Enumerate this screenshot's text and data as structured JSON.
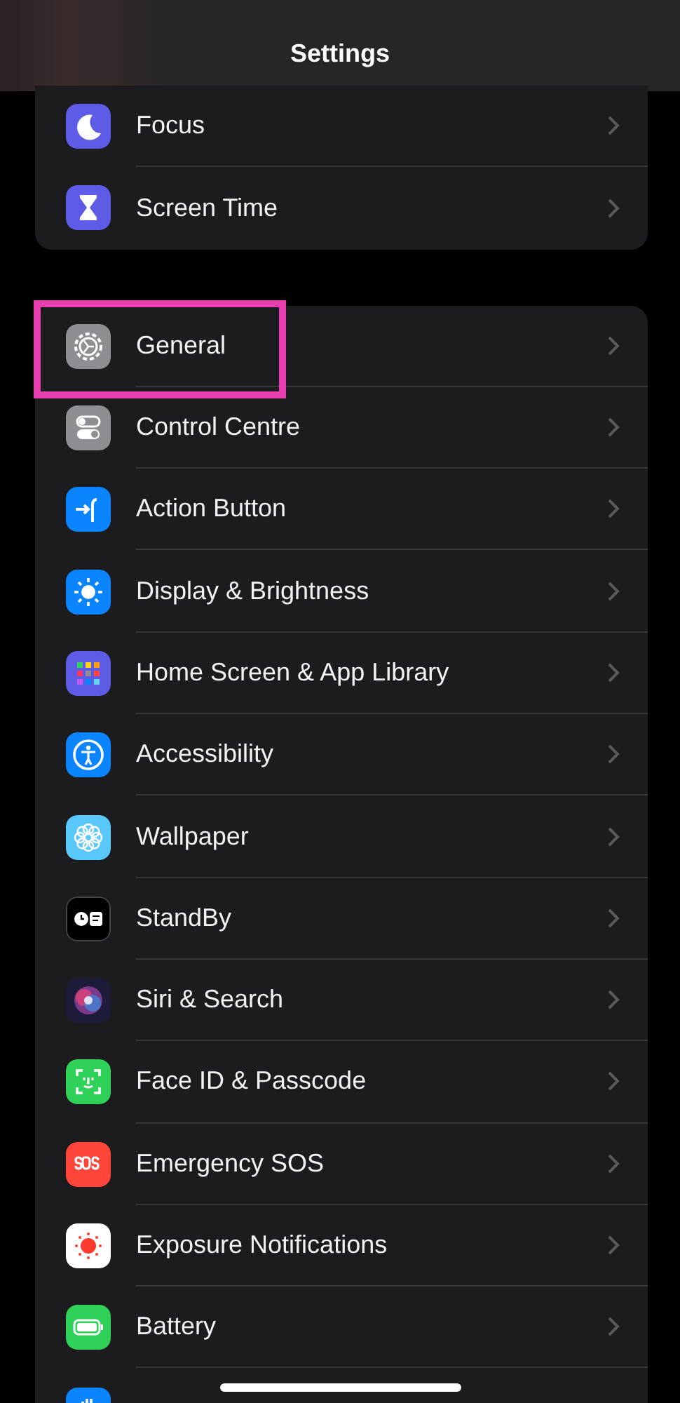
{
  "header": {
    "title": "Settings"
  },
  "groups": [
    {
      "items": [
        {
          "label": "Focus",
          "highlighted": false
        },
        {
          "label": "Screen Time",
          "highlighted": false
        }
      ]
    },
    {
      "items": [
        {
          "label": "General",
          "highlighted": true
        },
        {
          "label": "Control Centre",
          "highlighted": false
        },
        {
          "label": "Action Button",
          "highlighted": false
        },
        {
          "label": "Display & Brightness",
          "highlighted": false
        },
        {
          "label": "Home Screen & App Library",
          "highlighted": false
        },
        {
          "label": "Accessibility",
          "highlighted": false
        },
        {
          "label": "Wallpaper",
          "highlighted": false
        },
        {
          "label": "StandBy",
          "highlighted": false
        },
        {
          "label": "Siri & Search",
          "highlighted": false
        },
        {
          "label": "Face ID & Passcode",
          "highlighted": false
        },
        {
          "label": "Emergency SOS",
          "highlighted": false
        },
        {
          "label": "Exposure Notifications",
          "highlighted": false
        },
        {
          "label": "Battery",
          "highlighted": false
        }
      ]
    }
  ]
}
